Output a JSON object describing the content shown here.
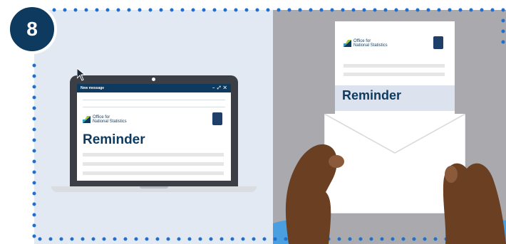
{
  "step": {
    "number": "8"
  },
  "laptop": {
    "window_title": "New message",
    "window_controls": "– ⤢ ✕",
    "logo_line1": "Office for",
    "logo_line2": "National Statistics",
    "heading": "Reminder"
  },
  "letter": {
    "logo_line1": "Office for",
    "logo_line2": "National Statistics",
    "heading": "Reminder"
  },
  "colors": {
    "navy": "#0e3a5f",
    "left_panel": "#e3e9f3",
    "right_panel": "#a9a9ae",
    "dots": "#1e6fd0",
    "skin": "#6b3f22"
  },
  "icons": [
    "cursor-arrow-icon",
    "ons-logo-icon",
    "crest-icon"
  ]
}
